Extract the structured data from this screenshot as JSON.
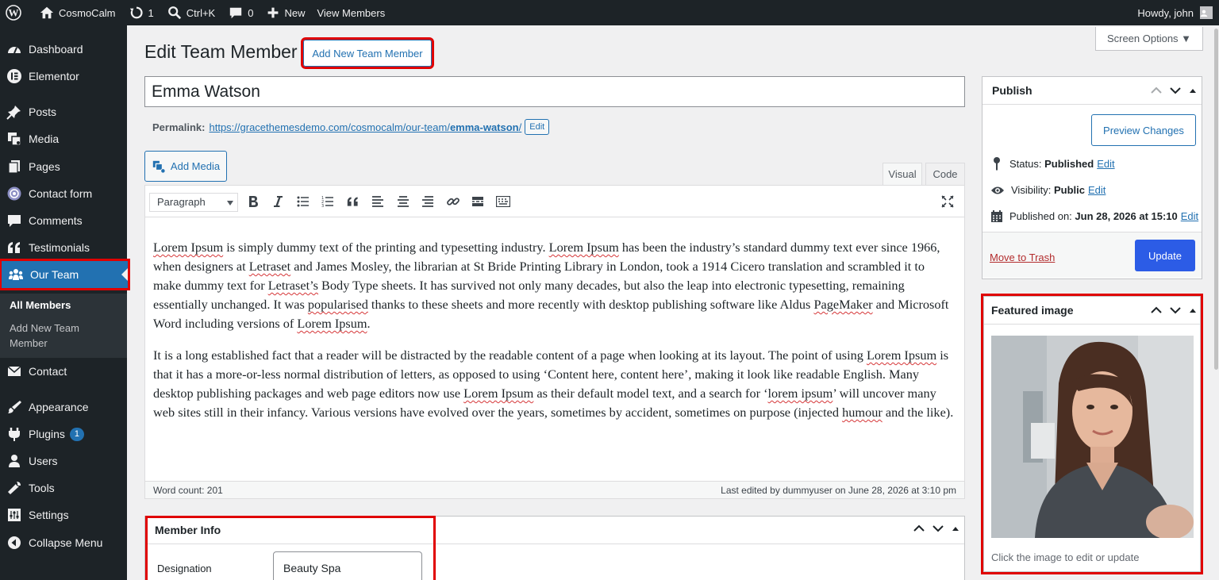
{
  "adminbar": {
    "site_name": "CosmoCalm",
    "updates_count": "1",
    "customize_shortcut": "Ctrl+K",
    "comments_count": "0",
    "new_label": "New",
    "view_label": "View Members",
    "howdy": "Howdy, john"
  },
  "sidebar": {
    "items": [
      {
        "label": "Dashboard",
        "icon": "dashboard-icon"
      },
      {
        "label": "Elementor",
        "icon": "elementor-icon"
      },
      {
        "label": "Posts",
        "icon": "pin-icon"
      },
      {
        "label": "Media",
        "icon": "media-icon"
      },
      {
        "label": "Pages",
        "icon": "pages-icon"
      },
      {
        "label": "Contact form",
        "icon": "contact-form-icon"
      },
      {
        "label": "Comments",
        "icon": "comment-icon"
      },
      {
        "label": "Testimonials",
        "icon": "quote-icon"
      },
      {
        "label": "Our Team",
        "icon": "groups-icon"
      },
      {
        "label": "Contact",
        "icon": "email-icon"
      },
      {
        "label": "Appearance",
        "icon": "brush-icon"
      },
      {
        "label": "Plugins",
        "icon": "plugin-icon",
        "badge": "1"
      },
      {
        "label": "Users",
        "icon": "users-icon"
      },
      {
        "label": "Tools",
        "icon": "wrench-icon"
      },
      {
        "label": "Settings",
        "icon": "settings-icon"
      },
      {
        "label": "Collapse Menu",
        "icon": "collapse-icon"
      }
    ],
    "submenu": {
      "all_members": "All Members",
      "add_new_line1": "Add New Team",
      "add_new_line2": "Member"
    }
  },
  "header": {
    "title": "Edit Team Member",
    "add_new_button": "Add New Team Member",
    "screen_options": "Screen Options ▼"
  },
  "post": {
    "title": "Emma Watson",
    "permalink_label": "Permalink:",
    "permalink_base": "https://gracethemesdemo.com/cosmocalm/our-team/",
    "permalink_slug": "emma-watson",
    "permalink_trail": "/",
    "permalink_edit": "Edit"
  },
  "editor": {
    "add_media": "Add Media",
    "tab_visual": "Visual",
    "tab_code": "Code",
    "format": "Paragraph",
    "word_count": "Word count: 201",
    "last_edited": "Last edited by dummyuser on June 28, 2026 at 3:10 pm",
    "content": {
      "p1": [
        "Lorem Ipsum",
        " is simply dummy text of the printing and typesetting industry. ",
        "Lorem Ipsum",
        " has been the industry’s standard dummy text ever since 1966, when designers at ",
        "Letraset",
        " and James Mosley, the librarian at St Bride Printing Library in London, took a 1914 Cicero translation and scrambled it to make dummy text for ",
        "Letraset’s",
        " Body Type sheets. It has survived not only many decades, but also the leap into electronic typesetting, remaining essentially unchanged. It was ",
        "popularised",
        " thanks to these sheets and more recently with desktop publishing software like Aldus ",
        "PageMaker",
        " and Microsoft Word including versions of ",
        "Lorem Ipsum",
        "."
      ],
      "p2": [
        "It is a long established fact that a reader will be distracted by the readable content of a page when looking at its layout. The point of using ",
        "Lorem Ipsum",
        " is that it has a more-or-less normal distribution of letters, as opposed to using ‘Content here, content here’, making it look like readable English. Many desktop publishing packages and web page editors now use ",
        "Lorem Ipsum",
        " as their default model text, and a search for ‘",
        "lorem ipsum",
        "’ will uncover many web sites still in their infancy. Various versions have evolved over the years, sometimes by accident, sometimes on purpose (injected ",
        "humour",
        " and the like)."
      ]
    }
  },
  "member_info": {
    "title": "Member Info",
    "designation_label": "Designation",
    "designation_value": "Beauty Spa"
  },
  "publish": {
    "title": "Publish",
    "preview": "Preview Changes",
    "status_label": "Status:",
    "status_value": "Published",
    "visibility_label": "Visibility:",
    "visibility_value": "Public",
    "published_label": "Published on:",
    "published_value": "Jun 28, 2026 at 15:10",
    "edit": "Edit",
    "trash": "Move to Trash",
    "update": "Update"
  },
  "featured": {
    "title": "Featured image",
    "hint": "Click the image to edit or update"
  },
  "colors": {
    "admin_dark": "#1d2327",
    "accent": "#2271b1",
    "button_primary": "#2c5ce6",
    "highlight": "#e00000"
  }
}
